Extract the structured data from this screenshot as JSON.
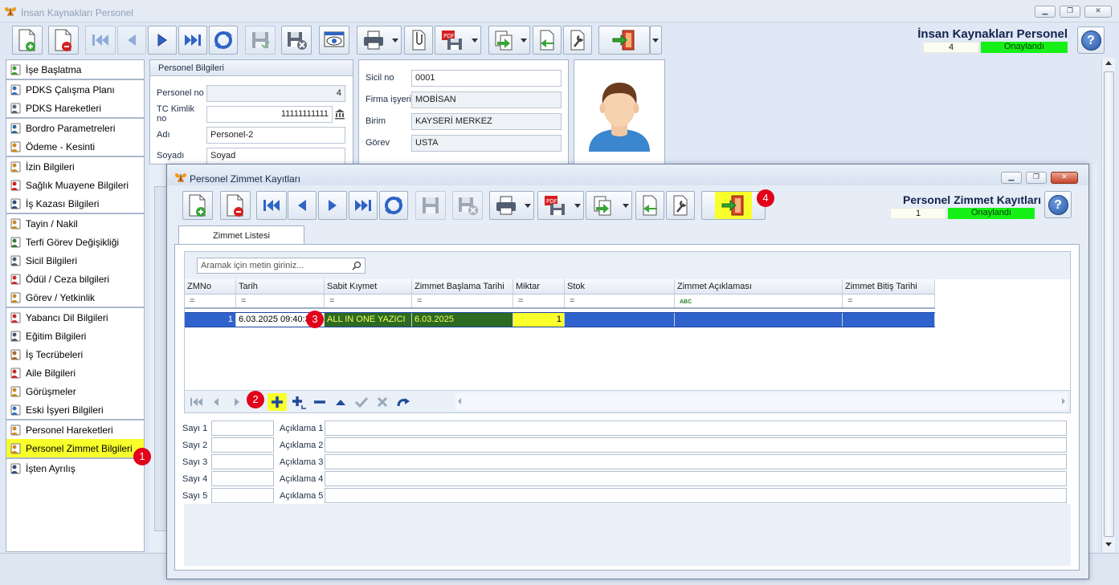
{
  "window": {
    "title": "İnsan Kaynakları Personel",
    "header_title": "İnsan Kaynakları Personel",
    "record_count": "4",
    "status": "Onaylandı",
    "help_label": "?"
  },
  "sidebar": {
    "groups": [
      [
        {
          "label": "İşe Başlatma",
          "icon": "flag-icon"
        }
      ],
      [
        {
          "label": "PDKS Çalışma Planı",
          "icon": "calendar-icon"
        },
        {
          "label": "PDKS Hareketleri",
          "icon": "list-icon"
        }
      ],
      [
        {
          "label": "Bordro Parametreleri",
          "icon": "calculator-icon"
        },
        {
          "label": "Ödeme - Kesinti",
          "icon": "money-icon"
        }
      ],
      [
        {
          "label": "İzin Bilgileri",
          "icon": "person-icon"
        },
        {
          "label": "Sağlık Muayene Bilgileri",
          "icon": "health-icon"
        },
        {
          "label": "İş Kazası Bilgileri",
          "icon": "accident-icon"
        }
      ],
      [
        {
          "label": "Tayin / Nakil",
          "icon": "people-icon"
        },
        {
          "label": "Terfi Görev Değişikliği",
          "icon": "chart-icon"
        },
        {
          "label": "Sicil Bilgileri",
          "icon": "document-icon"
        },
        {
          "label": "Ödül / Ceza bilgileri",
          "icon": "award-icon"
        },
        {
          "label": "Görev / Yetkinlik",
          "icon": "person-icon"
        }
      ],
      [
        {
          "label": "Yabancı Dil Bilgileri",
          "icon": "language-icon"
        },
        {
          "label": "Eğitim Bilgileri",
          "icon": "document-icon"
        },
        {
          "label": "İş Tecrübeleri",
          "icon": "briefcase-icon"
        },
        {
          "label": "Aile Bilgileri",
          "icon": "family-icon"
        },
        {
          "label": "Görüşmeler",
          "icon": "meeting-icon"
        },
        {
          "label": "Eski İşyeri Bilgileri",
          "icon": "info-icon"
        }
      ],
      [
        {
          "label": "Personel Hareketleri",
          "icon": "person-icon"
        },
        {
          "label": "Personel Zimmet Bilgileri",
          "icon": "person-icon",
          "active": true
        }
      ],
      [
        {
          "label": "İşten Ayrılış",
          "icon": "exit-icon"
        }
      ]
    ]
  },
  "personel": {
    "header": "Personel Bilgileri",
    "no_label": "Personel no",
    "no_value": "4",
    "tc_label": "TC Kimlik no",
    "tc_value": "11111111111",
    "adi_label": "Adı",
    "adi_value": "Personel-2",
    "soyadi_label": "Soyadı",
    "soyadi_value": "Soyad"
  },
  "sicil": {
    "sicil_label": "Sicil no",
    "sicil_value": "0001",
    "firma_label": "Firma işyeri",
    "firma_value": "MOBİSAN",
    "birim_label": "Birim",
    "birim_value": "KAYSERİ MERKEZ",
    "gorev_label": "Görev",
    "gorev_value": "USTA"
  },
  "dialog": {
    "title": "Personel Zimmet Kayıtları",
    "header_title": "Personel Zimmet Kayıtları",
    "record_count": "1",
    "status": "Onaylandı",
    "help_label": "?",
    "tab": "Zimmet Listesi",
    "search_placeholder": "Aramak için metin giriniz...",
    "columns": [
      "ZMNo",
      "Tarih",
      "Sabit Kıymet",
      "Zimmet Başlama Tarihi",
      "Miktar",
      "Stok",
      "Zimmet Açıklaması",
      "Zimmet Bitiş Tarihi"
    ],
    "filter_symbols": [
      "=",
      "=",
      "=",
      "=",
      "=",
      "=",
      "ABC",
      "="
    ],
    "row": {
      "zmno": "1",
      "tarih": "6.03.2025 09:40:3",
      "sabit": "ALL IN ONE YAZICI",
      "zbt": "6.03.2025",
      "miktar": "1",
      "stok": "",
      "aciklama": "",
      "bitis": ""
    },
    "extra_fields": [
      {
        "num_label": "Sayı 1",
        "text_label": "Açıklama 1"
      },
      {
        "num_label": "Sayı 2",
        "text_label": "Açıklama 2"
      },
      {
        "num_label": "Sayı 3",
        "text_label": "Açıklama 3"
      },
      {
        "num_label": "Sayı 4",
        "text_label": "Açıklama 4"
      },
      {
        "num_label": "Sayı 5",
        "text_label": "Açıklama 5"
      }
    ]
  },
  "annotations": [
    "1",
    "2",
    "3",
    "4"
  ],
  "colors": {
    "status_green": "#16f016",
    "highlight_yellow": "#f8ff2a",
    "selection_blue": "#2f62cc",
    "badge_red": "#e2001a"
  }
}
